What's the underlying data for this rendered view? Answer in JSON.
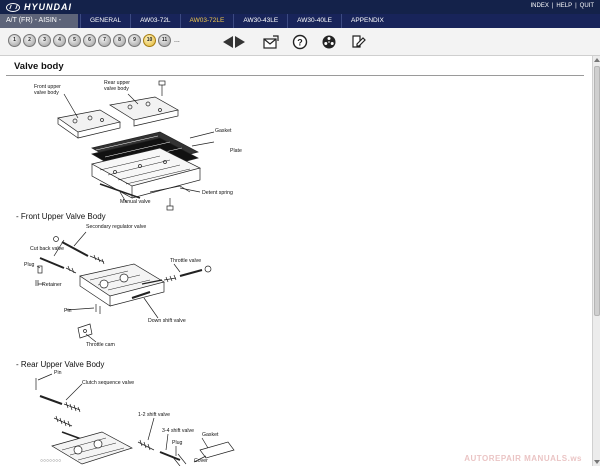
{
  "header": {
    "brand": "HYUNDAI",
    "links": [
      "INDEX",
      "|",
      "HELP",
      "|",
      "QUIT"
    ]
  },
  "nav": {
    "title": "A/T (FR) - AISIN -",
    "tabs": [
      "GENERAL",
      "AW03-72L",
      "AW03-72LE",
      "AW30-43LE",
      "AW30-40LE",
      "APPENDIX"
    ],
    "active_tab": "AW03-72LE",
    "accent_color": "#f2c94c"
  },
  "toolbar": {
    "pages": [
      "1",
      "2",
      "3",
      "4",
      "5",
      "6",
      "7",
      "8",
      "9",
      "10",
      "11"
    ],
    "active_page": "10",
    "more": "...",
    "tools": [
      "mail-icon",
      "help-icon",
      "film-reel-icon",
      "edit-icon"
    ]
  },
  "content": {
    "title": "Valve body",
    "sections": [
      "- Front Upper Valve Body",
      "- Rear Upper Valve Body"
    ],
    "fig1_labels": {
      "front_upper": "Front upper\nvalve body",
      "rear_upper": "Rear upper\nvalve body",
      "gasket": "Gasket",
      "plate": "Plate",
      "detent_spring": "Detent spring",
      "manual_valve": "Manual valve"
    },
    "fig2_labels": {
      "secondary": "Secondary regulator valve",
      "cut_back": "Cut back valve",
      "plug": "Plug",
      "retainer": "Retainer",
      "throttle_valve": "Throttle valve",
      "pin": "Pin",
      "down_shift": "Down shift valve",
      "throttle_cam": "Throttle cam"
    },
    "fig3_labels": {
      "pin": "Pin",
      "clutch_seq": "Clutch sequence valve",
      "shift12": "1-2 shift valve",
      "shift34": "3-4 shift valve",
      "plug": "Plug",
      "gasket": "Gasket",
      "cover": "Cover"
    },
    "footer_dots": "○○○○○○○",
    "watermark": "AUTOREPAIR MANUALS.ws"
  }
}
